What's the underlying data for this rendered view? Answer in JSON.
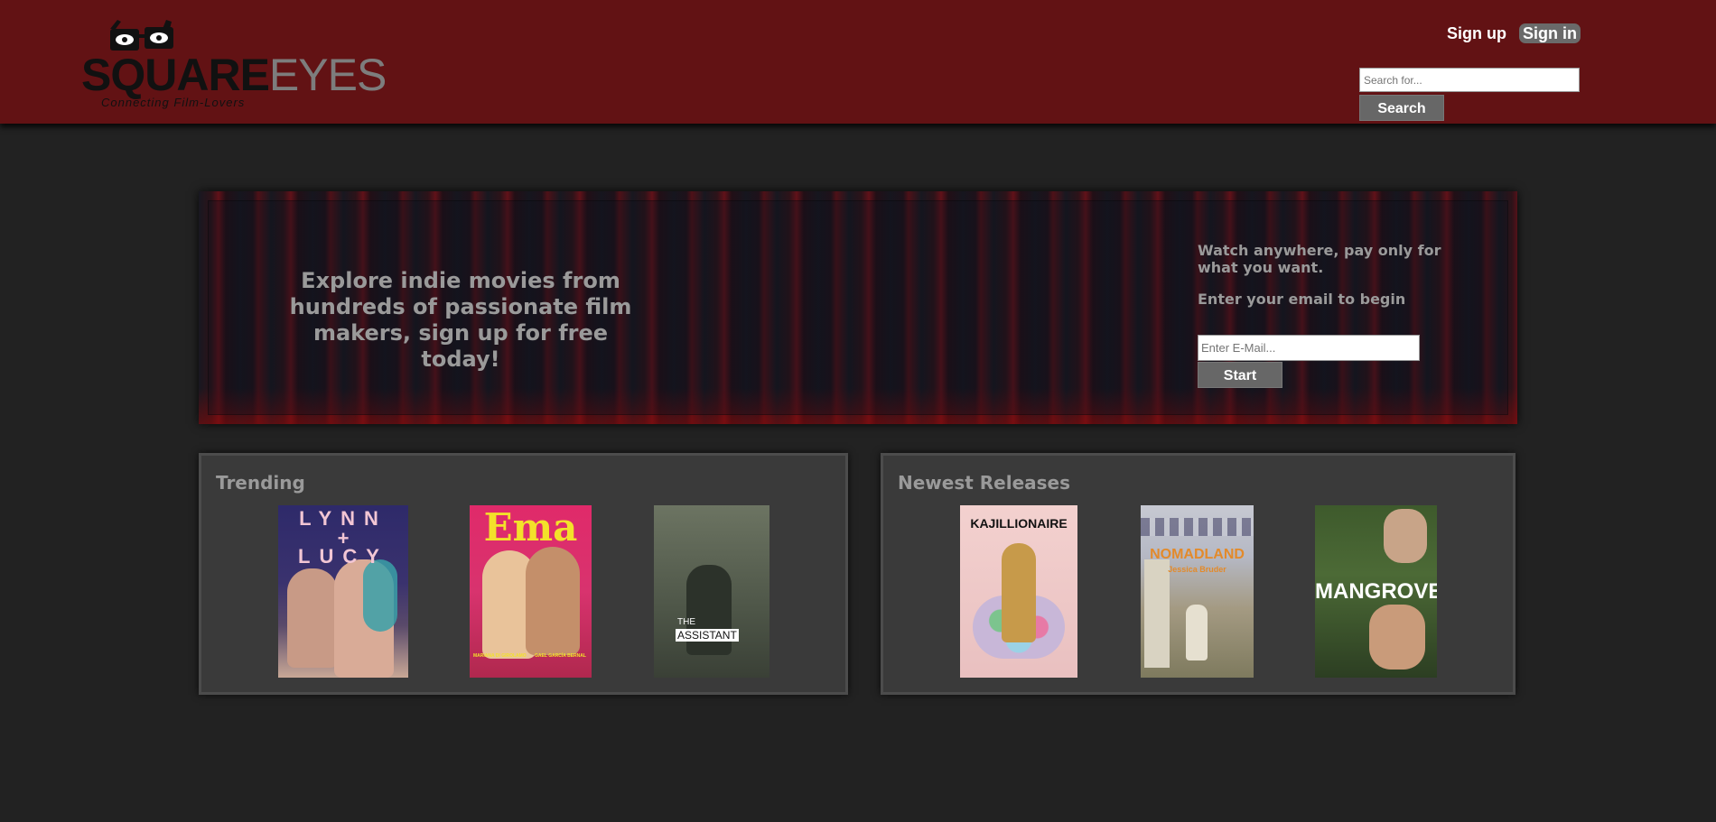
{
  "header": {
    "logo": {
      "word_dark": "SQUARE",
      "word_light": "EYES",
      "tagline": "Connecting Film-Lovers"
    },
    "auth": {
      "signup": "Sign up",
      "signin": "Sign in"
    },
    "search": {
      "placeholder": "Search for...",
      "button": "Search"
    }
  },
  "hero": {
    "headline": "Explore indie movies from hundreds of passionate film makers, sign up for free today!",
    "line1": "Watch anywhere, pay only for what you want.",
    "line2": "Enter your email to begin",
    "email_placeholder": "Enter E-Mail...",
    "button": "Start"
  },
  "trending": {
    "title": "Trending",
    "posters": [
      {
        "name": "lynn-lucy",
        "text": [
          "LYNN",
          "+",
          "LUCY"
        ]
      },
      {
        "name": "ema",
        "text": [
          "Ema",
          "MARIANA DI GIROLAMO",
          "GAEL GARCÍA BERNAL"
        ]
      },
      {
        "name": "the-assistant",
        "text": [
          "THE",
          "ASSISTANT"
        ]
      }
    ]
  },
  "newest": {
    "title": "Newest Releases",
    "posters": [
      {
        "name": "kajillionaire",
        "text": [
          "KAJILLIONAIRE"
        ]
      },
      {
        "name": "nomadland",
        "text": [
          "NOMADLAND",
          "Jessica Bruder"
        ]
      },
      {
        "name": "mangrove",
        "text": [
          "MANGROVE"
        ]
      }
    ]
  },
  "colors": {
    "header": "#621214",
    "background": "#222222",
    "panel": "#3a3a3a",
    "button": "#676767"
  }
}
